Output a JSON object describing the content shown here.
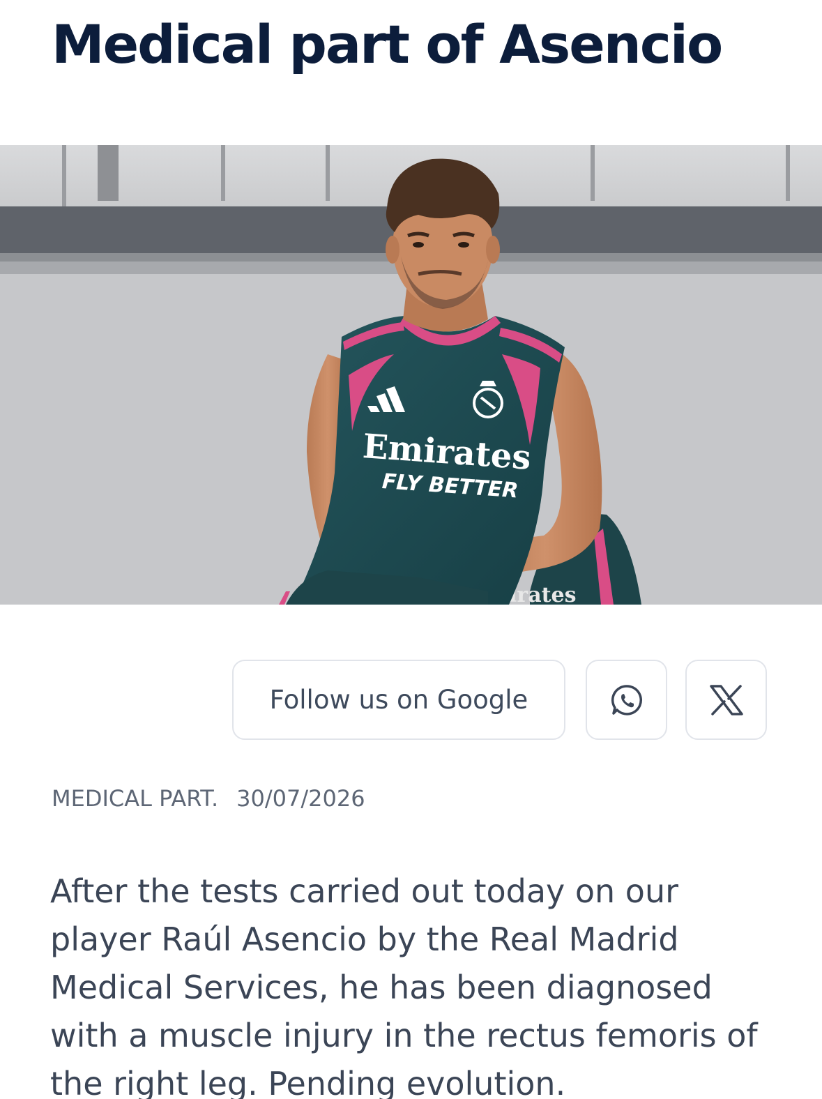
{
  "article": {
    "title": "Medical part of Asencio",
    "hero_image": {
      "alt": "Raúl Asencio training",
      "jersey_sponsor": "Emirates",
      "jersey_tagline": "FLY BETTER",
      "background_jersey_text": "irates"
    },
    "category": "MEDICAL PART.",
    "date": "30/07/2026",
    "body": "After the tests carried out today on our player Raúl Asencio by the Real Madrid Medical Services, he has been diagnosed with a muscle injury in the rectus femoris of the right leg. Pending evolution."
  },
  "share": {
    "follow_label": "Follow us on Google",
    "whatsapp_icon": "whatsapp-icon",
    "x_icon": "x-icon"
  },
  "colors": {
    "title": "#0c1d3b",
    "body": "#3b4556",
    "meta": "#5d6675",
    "button_border": "#e1e4ea",
    "jersey": "#1f4a50",
    "jersey_accent": "#d94d86"
  }
}
